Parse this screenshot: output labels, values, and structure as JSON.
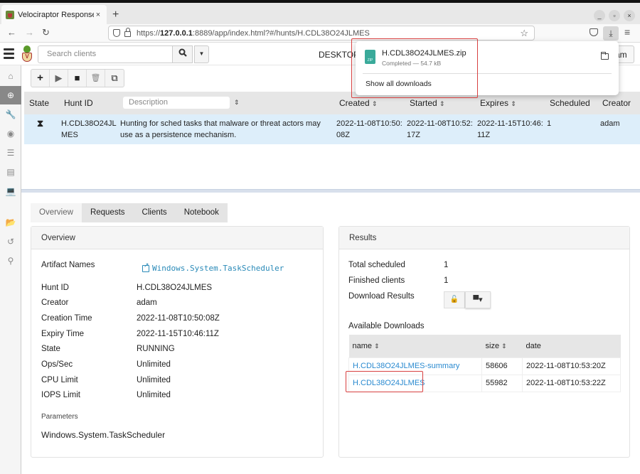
{
  "browser": {
    "tab_title": "Velociraptor Response an",
    "tab_close": "×",
    "new_tab": "+",
    "url_prefix": "https://",
    "url_host": "127.0.0.1",
    "url_rest": ":8889/app/index.html?#/hunts/H.CDL38O24JLMES",
    "window_controls": {
      "minimize": "_",
      "maximize": "▫",
      "close": "×"
    },
    "nav": {
      "back": "←",
      "forward": "→",
      "reload": "↻",
      "bookmark": "☆",
      "downloads": "⤓",
      "menu": "≡"
    }
  },
  "downloads_popup": {
    "file_name": "H.CDL38O24JLMES.zip",
    "status": "Completed — 54.7 kB",
    "zip_label": "ZIP",
    "show_all": "Show all downloads"
  },
  "app_header": {
    "search_placeholder": "Search clients",
    "search_icon": "🔍",
    "hostname": "DESKTOP-",
    "user": "am"
  },
  "sidebar": {
    "items": [
      {
        "name": "home",
        "glyph": "⌂"
      },
      {
        "name": "hunt-manager",
        "glyph": "⊕",
        "active": true
      },
      {
        "name": "artifacts",
        "glyph": "🔧"
      },
      {
        "name": "view",
        "glyph": "◉"
      },
      {
        "name": "server-events",
        "glyph": "☰"
      },
      {
        "name": "server-artifacts",
        "glyph": "▤"
      },
      {
        "name": "clients",
        "glyph": "💻"
      },
      {
        "name": "files",
        "glyph": "📂"
      },
      {
        "name": "history",
        "glyph": "↺"
      },
      {
        "name": "investigate",
        "glyph": "⚲"
      }
    ]
  },
  "toolbar": {
    "buttons": [
      {
        "name": "new-hunt",
        "glyph": "+"
      },
      {
        "name": "run-hunt",
        "glyph": "▶"
      },
      {
        "name": "stop-hunt",
        "glyph": "■"
      },
      {
        "name": "delete-hunt",
        "glyph": "🗑"
      },
      {
        "name": "copy-hunt",
        "glyph": "⧉"
      }
    ]
  },
  "hunts_table": {
    "columns": {
      "state": "State",
      "hunt_id": "Hunt ID",
      "description_placeholder": "Description",
      "created": "Created",
      "started": "Started",
      "expires": "Expires",
      "scheduled": "Scheduled",
      "creator": "Creator",
      "sort": "⇕"
    },
    "rows": [
      {
        "state_icon": "⧗",
        "hunt_id_1": "H.CDL38O24JL",
        "hunt_id_2": "MES",
        "description_1": "Hunting for sched tasks that malware or threat actors may",
        "description_2": "use as a persistence mechanism.",
        "created_1": "2022-11-08T10:50:",
        "created_2": "08Z",
        "started_1": "2022-11-08T10:52:",
        "started_2": "17Z",
        "expires_1": "2022-11-15T10:46:",
        "expires_2": "11Z",
        "scheduled": "1",
        "creator": "adam"
      }
    ]
  },
  "detail_tabs": [
    "Overview",
    "Requests",
    "Clients",
    "Notebook"
  ],
  "overview": {
    "title": "Overview",
    "fields": [
      {
        "key": "Artifact Names",
        "value": "Windows.System.TaskScheduler"
      },
      {
        "key": "Hunt ID",
        "value": "H.CDL38O24JLMES"
      },
      {
        "key": "Creator",
        "value": "adam"
      },
      {
        "key": "Creation Time",
        "value": "2022-11-08T10:50:08Z"
      },
      {
        "key": "Expiry Time",
        "value": "2022-11-15T10:46:11Z"
      },
      {
        "key": "State",
        "value": "RUNNING"
      },
      {
        "key": "Ops/Sec",
        "value": "Unlimited"
      },
      {
        "key": "CPU Limit",
        "value": "Unlimited"
      },
      {
        "key": "IOPS Limit",
        "value": "Unlimited"
      }
    ],
    "parameters_label": "Parameters",
    "parameters_value": "Windows.System.TaskScheduler"
  },
  "results": {
    "title": "Results",
    "total_scheduled_label": "Total scheduled",
    "total_scheduled": "1",
    "finished_clients_label": "Finished clients",
    "finished_clients": "1",
    "download_results_label": "Download Results",
    "lock_glyph": "🔓",
    "archive_glyph": "▀▾",
    "available_downloads_label": "Available Downloads",
    "downloads_columns": {
      "name": "name",
      "size": "size",
      "date": "date",
      "sort": "⇕"
    },
    "downloads": [
      {
        "name": "H.CDL38O24JLMES-summary",
        "size": "58606",
        "date": "2022-11-08T10:53:20Z"
      },
      {
        "name": "H.CDL38O24JLMES",
        "size": "55982",
        "date": "2022-11-08T10:53:22Z"
      }
    ]
  },
  "colors": {
    "link": "#2a8ad0",
    "highlight_box": "#d84040",
    "selected_row": "#ddeefa"
  }
}
